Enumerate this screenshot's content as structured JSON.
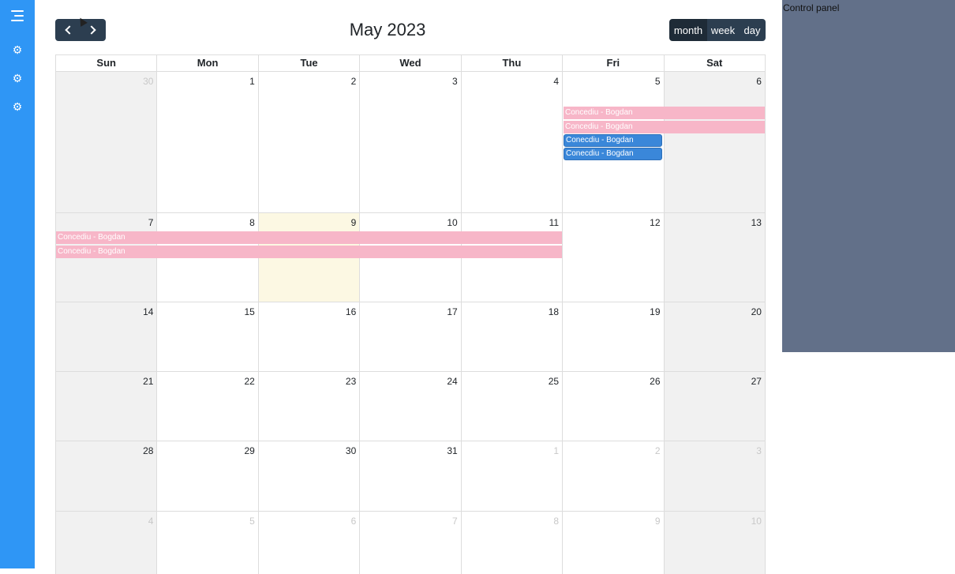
{
  "sidebar": {
    "menu_icon": "hamburger-icon",
    "items": [
      {
        "icon": "gear-icon",
        "glyph": "⚙"
      },
      {
        "icon": "gear-icon",
        "glyph": "⚙"
      },
      {
        "icon": "gear-icon",
        "glyph": "⚙"
      }
    ]
  },
  "toolbar": {
    "title": "May 2023",
    "views": {
      "month": "month",
      "week": "week",
      "day": "day"
    },
    "active_view": "month"
  },
  "calendar": {
    "weekdays": [
      "Sun",
      "Mon",
      "Tue",
      "Wed",
      "Thu",
      "Fri",
      "Sat"
    ],
    "weeks": [
      [
        "30",
        "1",
        "2",
        "3",
        "4",
        "5",
        "6"
      ],
      [
        "7",
        "8",
        "9",
        "10",
        "11",
        "12",
        "13"
      ],
      [
        "14",
        "15",
        "16",
        "17",
        "18",
        "19",
        "20"
      ],
      [
        "21",
        "22",
        "23",
        "24",
        "25",
        "26",
        "27"
      ],
      [
        "28",
        "29",
        "30",
        "31",
        "1",
        "2",
        "3"
      ],
      [
        "4",
        "5",
        "6",
        "7",
        "8",
        "9",
        "10"
      ]
    ],
    "today": "May 9",
    "events": {
      "e1": "Concediu - Bogdan",
      "e2": "Concediu - Bogdan",
      "e3": "Conecdiu - Bogdan",
      "e4": "Conecdiu - Bogdan",
      "e5": "Concediu - Bogdan",
      "e6": "Concediu - Bogdan"
    },
    "colors": {
      "pink": "#f7b6c8",
      "blue": "#3a87d9",
      "today": "#fcf8e3",
      "weekend": "#f1f1f1"
    }
  },
  "control_panel": {
    "label": "Control panel"
  }
}
